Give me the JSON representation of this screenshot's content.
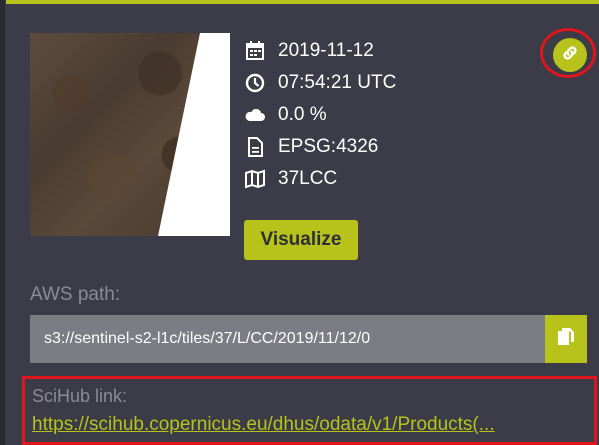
{
  "product": {
    "date": "2019-11-12",
    "time": "07:54:21 UTC",
    "cloud": "0.0 %",
    "crs": "EPSG:4326",
    "tile": "37LCC"
  },
  "icons": {
    "date": "calendar-icon",
    "time": "clock-icon",
    "cloud": "cloud-icon",
    "crs": "document-icon",
    "tile": "map-icon",
    "link": "link-icon",
    "copy": "copy-icon"
  },
  "buttons": {
    "visualize": "Visualize"
  },
  "aws": {
    "label": "AWS path:",
    "path": "s3://sentinel-s2-l1c/tiles/37/L/CC/2019/11/12/0"
  },
  "scihub": {
    "label": "SciHub link:",
    "link": "https://scihub.copernicus.eu/dhus/odata/v1/Products(..."
  },
  "colors": {
    "accent": "#b7c21b",
    "panel": "#3b3c47",
    "highlight": "#e0161f"
  }
}
